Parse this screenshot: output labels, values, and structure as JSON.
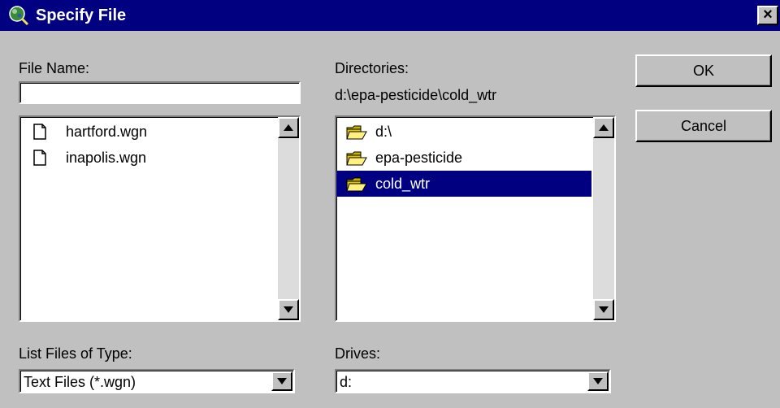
{
  "window": {
    "title": "Specify File",
    "close_label": "×"
  },
  "file_name": {
    "label": "File Name:",
    "value": ""
  },
  "files": {
    "items": [
      {
        "label": "hartford.wgn",
        "icon": "document-icon"
      },
      {
        "label": "inapolis.wgn",
        "icon": "document-icon"
      }
    ]
  },
  "directories": {
    "label": "Directories:",
    "current_path": "d:\\epa-pesticide\\cold_wtr",
    "items": [
      {
        "label": "d:\\",
        "icon": "open-folder-icon",
        "selected": false
      },
      {
        "label": "epa-pesticide",
        "icon": "open-folder-icon",
        "selected": false
      },
      {
        "label": "cold_wtr",
        "icon": "open-folder-icon",
        "selected": true
      }
    ]
  },
  "file_type": {
    "label": "List Files of Type:",
    "selected": "Text Files (*.wgn)"
  },
  "drives": {
    "label": "Drives:",
    "selected": "d:"
  },
  "buttons": {
    "ok": "OK",
    "cancel": "Cancel"
  },
  "colors": {
    "titlebar": "#000080",
    "face": "#c0c0c0",
    "selection": "#000080"
  }
}
